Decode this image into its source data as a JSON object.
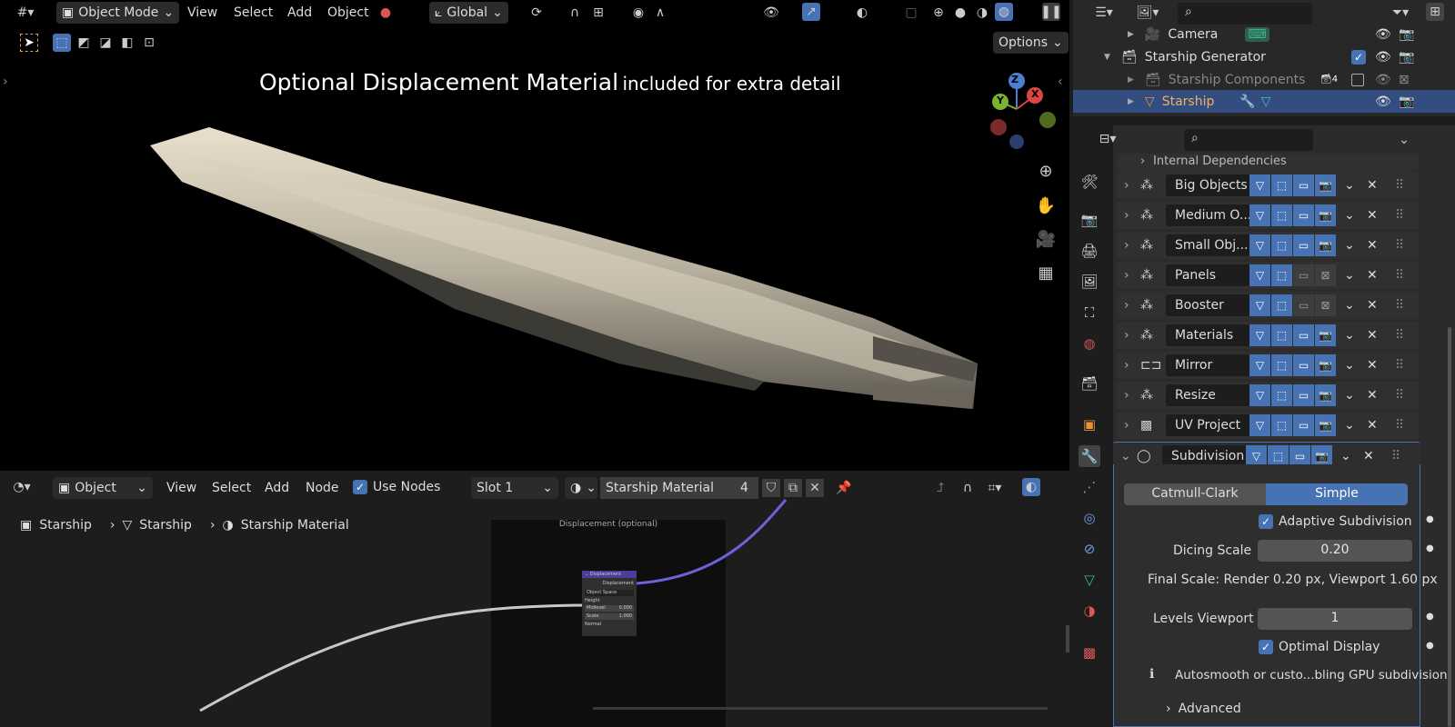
{
  "viewport": {
    "header": {
      "editor_type_icon": "grid-icon",
      "mode": "Object Mode",
      "menus": [
        "View",
        "Select",
        "Add",
        "Object"
      ],
      "orientation": "Global",
      "options_label": "Options"
    },
    "overlay_text_bold": "Optional Displacement Material",
    "overlay_text_rest": "included for extra detail",
    "gizmo": {
      "x": "X",
      "y": "Y",
      "z": "Z"
    }
  },
  "node_editor": {
    "editor_type": "Object",
    "menus": [
      "View",
      "Select",
      "Add",
      "Node"
    ],
    "use_nodes_label": "Use Nodes",
    "use_nodes": true,
    "slot": "Slot 1",
    "material": "Starship Material",
    "users": "4",
    "breadcrumb": [
      "Starship",
      "Starship",
      "Starship Material"
    ],
    "frame_label": "Displacement (optional)",
    "node": {
      "title": "Displacement",
      "output": "Displacement",
      "space": "Object Space",
      "inputs": [
        {
          "label": "Height"
        },
        {
          "label": "Midlevel",
          "value": "0.000"
        },
        {
          "label": "Scale",
          "value": "1.000"
        },
        {
          "label": "Normal"
        }
      ]
    }
  },
  "outliner": {
    "rows": [
      {
        "label": "Camera",
        "indent": 1,
        "type": "camera"
      },
      {
        "label": "Starship Generator",
        "indent": 0,
        "type": "collection"
      },
      {
        "label": "Starship Components",
        "indent": 1,
        "type": "collection",
        "badge": "4",
        "dim": true
      },
      {
        "label": "Starship",
        "indent": 1,
        "type": "mesh",
        "selected": true
      }
    ]
  },
  "properties": {
    "partial_header": "Internal Dependencies",
    "modifiers": [
      {
        "name": "Big Objects",
        "viewport": true,
        "render": true
      },
      {
        "name": "Medium O...",
        "viewport": true,
        "render": true
      },
      {
        "name": "Small Obj...",
        "viewport": true,
        "render": true
      },
      {
        "name": "Panels",
        "viewport": false,
        "render": false
      },
      {
        "name": "Booster",
        "viewport": false,
        "render": false
      },
      {
        "name": "Materials",
        "viewport": true,
        "render": true
      },
      {
        "name": "Mirror",
        "viewport": true,
        "render": true
      },
      {
        "name": "Resize",
        "viewport": true,
        "render": true
      },
      {
        "name": "UV Project",
        "viewport": true,
        "render": true
      },
      {
        "name": "Subdivision",
        "viewport": true,
        "render": true
      }
    ],
    "subdivision": {
      "type_options": [
        "Catmull-Clark",
        "Simple"
      ],
      "selected_type": "Simple",
      "adaptive_label": "Adaptive Subdivision",
      "dicing_label": "Dicing Scale",
      "dicing_value": "0.20",
      "final_scale": "Final Scale: Render 0.20 px, Viewport 1.60 px",
      "levels_label": "Levels Viewport",
      "levels_value": "1",
      "optimal_label": "Optimal Display",
      "info": "Autosmooth or custo...bling GPU subdivision",
      "advanced_label": "Advanced"
    }
  },
  "colors": {
    "accent": "#4772b3",
    "selected_row": "#334d80",
    "node_header": "#4b3e9a"
  }
}
